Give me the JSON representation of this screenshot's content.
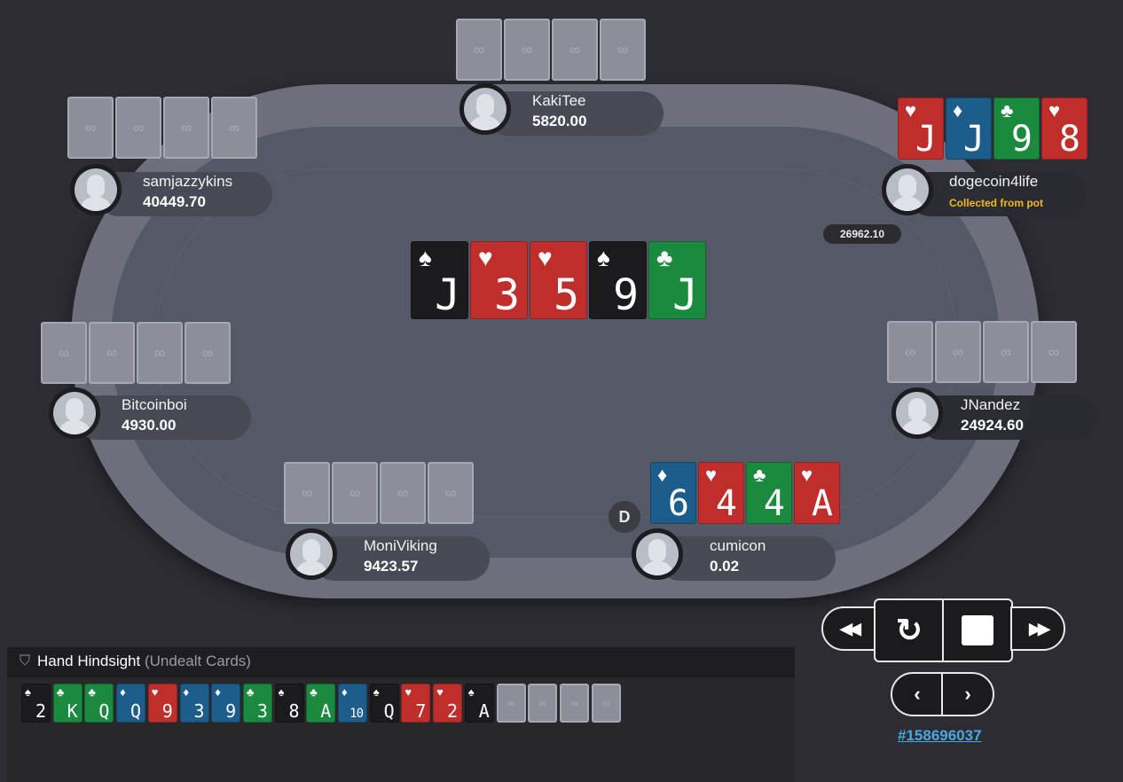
{
  "players": [
    {
      "name": "KakiTee",
      "stack": "5820.00"
    },
    {
      "name": "samjazzykins",
      "stack": "40449.70"
    },
    {
      "name": "dogecoin4life",
      "status": "Collected from pot"
    },
    {
      "name": "Bitcoinboi",
      "stack": "4930.00"
    },
    {
      "name": "JNandez",
      "stack": "24924.60"
    },
    {
      "name": "MoniViking",
      "stack": "9423.57"
    },
    {
      "name": "cumicon",
      "stack": "0.02"
    }
  ],
  "pot_amount": "26962.10",
  "dealer_label": "D",
  "board": [
    {
      "rank": "J",
      "suit": "spade",
      "color": "#1b1b1d"
    },
    {
      "rank": "3",
      "suit": "heart",
      "color": "#bf2e2b"
    },
    {
      "rank": "5",
      "suit": "heart",
      "color": "#bf2e2b"
    },
    {
      "rank": "9",
      "suit": "spade",
      "color": "#1b1b1d"
    },
    {
      "rank": "J",
      "suit": "club",
      "color": "#1a8a3e"
    }
  ],
  "dogecoin_cards": [
    {
      "rank": "J",
      "suit": "heart",
      "color": "#bf2e2b"
    },
    {
      "rank": "J",
      "suit": "diamond",
      "color": "#1d5d8c"
    },
    {
      "rank": "9",
      "suit": "club",
      "color": "#1a8a3e"
    },
    {
      "rank": "8",
      "suit": "heart",
      "color": "#bf2e2b"
    }
  ],
  "cumicon_cards": [
    {
      "rank": "6",
      "suit": "diamond",
      "color": "#1d5d8c"
    },
    {
      "rank": "4",
      "suit": "heart",
      "color": "#bf2e2b"
    },
    {
      "rank": "4",
      "suit": "club",
      "color": "#1a8a3e"
    },
    {
      "rank": "A",
      "suit": "heart",
      "color": "#bf2e2b"
    }
  ],
  "hindsight": {
    "title": "Hand Hindsight",
    "subtitle": "(Undealt Cards)",
    "cards": [
      {
        "rank": "2",
        "suit": "spade",
        "color": "#1b1b1d"
      },
      {
        "rank": "K",
        "suit": "club",
        "color": "#1a8a3e"
      },
      {
        "rank": "Q",
        "suit": "club",
        "color": "#1a8a3e"
      },
      {
        "rank": "Q",
        "suit": "diamond",
        "color": "#1d5d8c"
      },
      {
        "rank": "9",
        "suit": "heart",
        "color": "#bf2e2b"
      },
      {
        "rank": "3",
        "suit": "diamond",
        "color": "#1d5d8c"
      },
      {
        "rank": "9",
        "suit": "diamond",
        "color": "#1d5d8c"
      },
      {
        "rank": "3",
        "suit": "club",
        "color": "#1a8a3e"
      },
      {
        "rank": "8",
        "suit": "spade",
        "color": "#1b1b1d"
      },
      {
        "rank": "A",
        "suit": "club",
        "color": "#1a8a3e"
      },
      {
        "rank": "10",
        "suit": "diamond",
        "color": "#1d5d8c"
      },
      {
        "rank": "Q",
        "suit": "spade",
        "color": "#1b1b1d"
      },
      {
        "rank": "7",
        "suit": "heart",
        "color": "#bf2e2b"
      },
      {
        "rank": "2",
        "suit": "heart",
        "color": "#bf2e2b"
      },
      {
        "rank": "A",
        "suit": "spade",
        "color": "#1b1b1d"
      }
    ],
    "hidden_count": 4
  },
  "controls": {
    "rewind_icon": "rewind-icon",
    "replay_icon": "replay-icon",
    "stop_icon": "stop-icon",
    "fast_forward_icon": "fast-forward-icon",
    "prev_icon": "chevron-left-icon",
    "next_icon": "chevron-right-icon"
  },
  "hand_id": "#158696037"
}
